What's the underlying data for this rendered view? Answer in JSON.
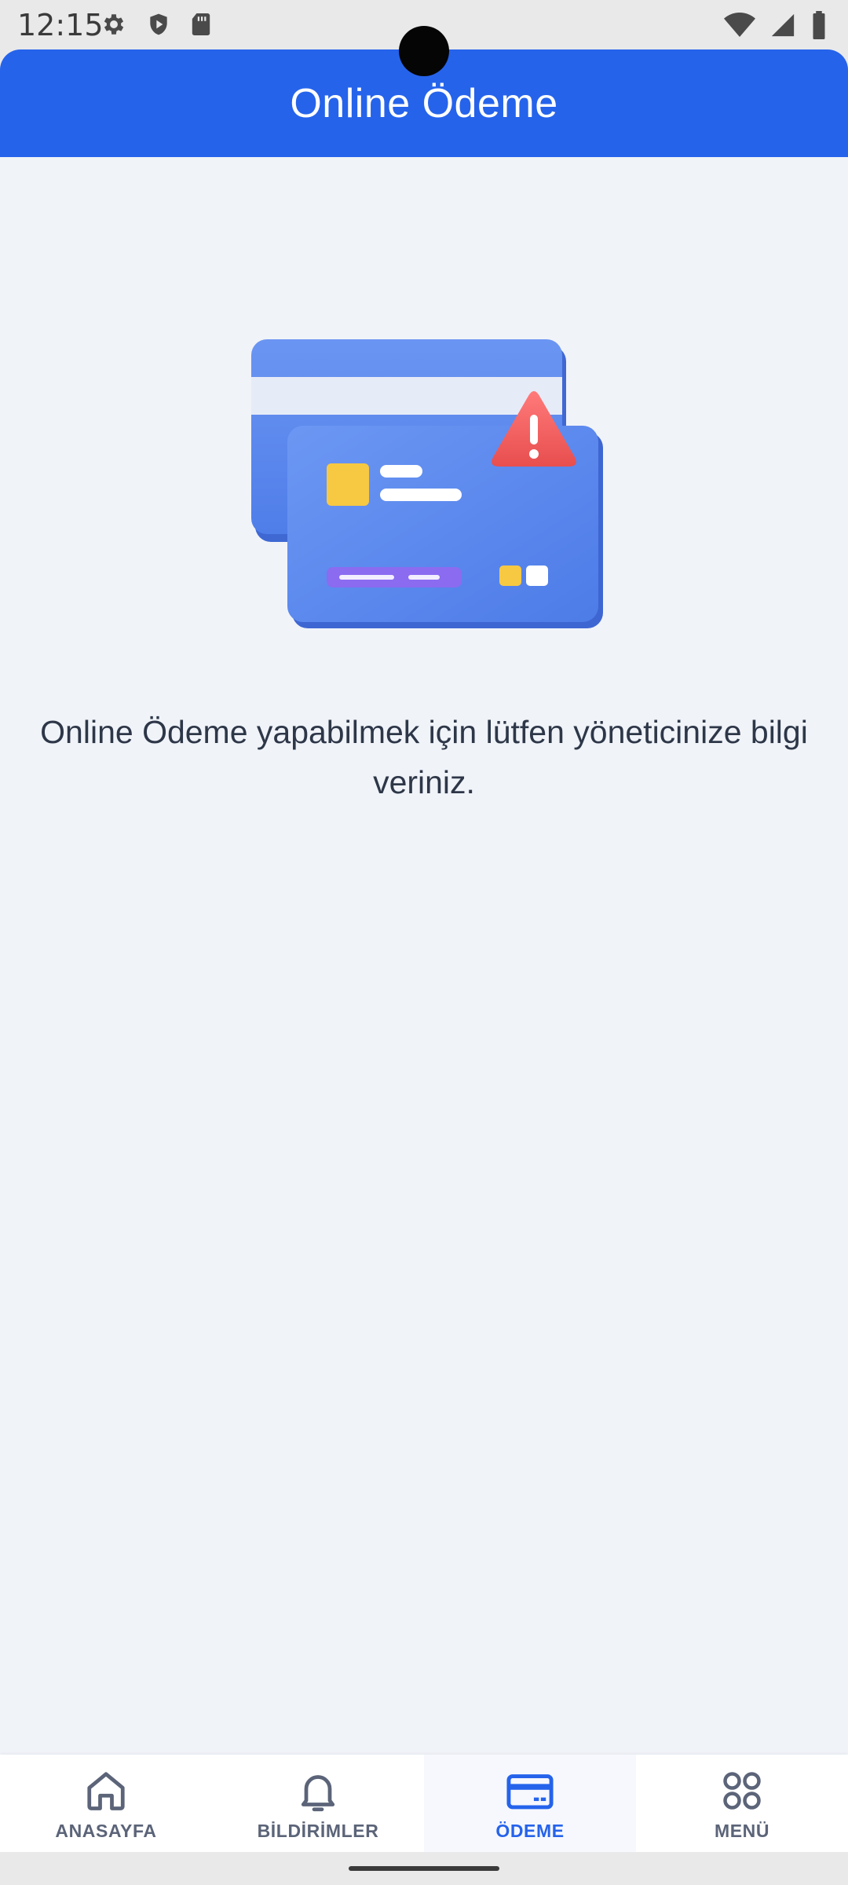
{
  "status_bar": {
    "time": "12:15",
    "left_icons": [
      "gear-icon",
      "shield-icon",
      "sd-card-icon"
    ],
    "right_icons": [
      "wifi-icon",
      "signal-icon",
      "battery-icon"
    ]
  },
  "header": {
    "title": "Online Ödeme"
  },
  "main": {
    "illustration": "credit-card-warning-icon",
    "message": "Online Ödeme yapabilmek için lütfen yöneticinize bilgi veriniz."
  },
  "bottom_nav": {
    "items": [
      {
        "label": "ANASAYFA",
        "icon": "home-icon",
        "active": false
      },
      {
        "label": "BİLDİRİMLER",
        "icon": "bell-icon",
        "active": false
      },
      {
        "label": "ÖDEME",
        "icon": "credit-card-icon",
        "active": true
      },
      {
        "label": "MENÜ",
        "icon": "grid-circles-icon",
        "active": false
      }
    ]
  },
  "colors": {
    "primary": "#2563eb",
    "background": "#f0f3f8",
    "text": "#2d3748",
    "inactive_nav": "#5b6478"
  }
}
